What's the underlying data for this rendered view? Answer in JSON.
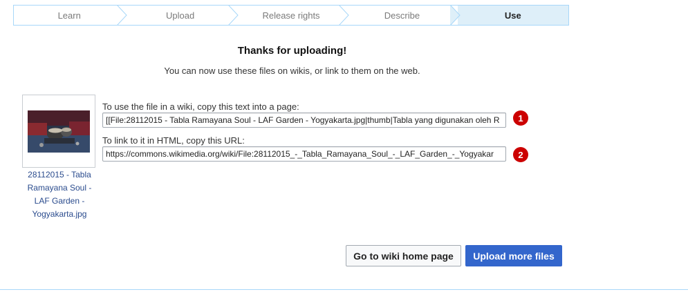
{
  "steps": [
    {
      "label": "Learn",
      "active": false
    },
    {
      "label": "Upload",
      "active": false
    },
    {
      "label": "Release rights",
      "active": false
    },
    {
      "label": "Describe",
      "active": false
    },
    {
      "label": "Use",
      "active": true
    }
  ],
  "heading": "Thanks for uploading!",
  "subtext": "You can now use these files on wikis, or link to them on the web.",
  "file": {
    "caption_lines": [
      "28112015 - Tabla",
      "Ramayana Soul -",
      "LAF Garden -",
      "Yogyakarta.jpg"
    ]
  },
  "wiki_field": {
    "label": "To use the file in a wiki, copy this text into a page:",
    "value": "[[File:28112015 - Tabla Ramayana Soul - LAF Garden - Yogyakarta.jpg|thumb|Tabla yang digunakan oleh R",
    "badge": "1"
  },
  "url_field": {
    "label": "To link to it in HTML, copy this URL:",
    "value": "https://commons.wikimedia.org/wiki/File:28112015_-_Tabla_Ramayana_Soul_-_LAF_Garden_-_Yogyakar",
    "badge": "2"
  },
  "buttons": {
    "home": "Go to wiki home page",
    "more": "Upload more files"
  },
  "colors": {
    "accent": "#3366cc",
    "link": "#2a4b8d",
    "step_active_bg": "#deeff9",
    "step_border": "#a7d7f9",
    "badge": "#cc0000"
  }
}
